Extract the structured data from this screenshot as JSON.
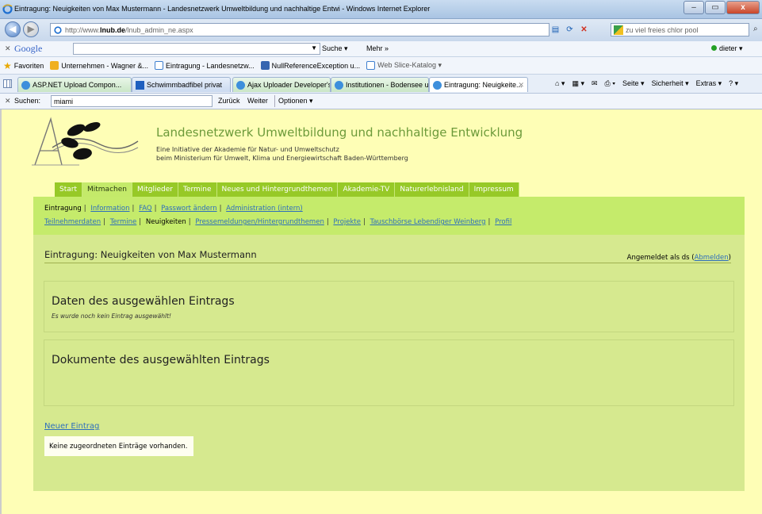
{
  "window": {
    "title": "Eintragung: Neuigkeiten von Max Mustermann - Landesnetzwerk Umweltbildung und nachhaltige Entwi - Windows Internet Explorer",
    "minimize": "–",
    "maximize": "▭",
    "close": "x"
  },
  "address": {
    "url_prefix": "http://www.",
    "url_domain": "lnub.de",
    "url_path": "/lnub_admin_ne.aspx",
    "search_value": "zu viel freies chlor pool"
  },
  "google": {
    "logo": "Google",
    "search_label": "Suche ▾",
    "more_label": "Mehr »",
    "user_label": "dieter ▾"
  },
  "favorites": {
    "label": "Favoriten",
    "items": [
      "Unternehmen - Wagner &...",
      "Eintragung - Landesnetzw...",
      "NullReferenceException u...",
      "Web Slice-Katalog ▾"
    ]
  },
  "tabs": [
    "ASP.NET Upload Compon...",
    "Schwimmbadfibel privat",
    "Ajax Uploader Developer's ...",
    "Institutionen - Bodensee u...",
    "Eintragung: Neuigkeite..."
  ],
  "toolbar_tools": [
    "Seite ▾",
    "Sicherheit ▾",
    "Extras ▾"
  ],
  "findbar": {
    "label": "Suchen:",
    "value": "miami",
    "prev": "Zurück",
    "next": "Weiter",
    "options": "Optionen ▾"
  },
  "site": {
    "title": "Landesnetzwerk Umweltbildung und nachhaltige Entwicklung",
    "subline1": "Eine Initiative der Akademie für Natur- und Umweltschutz",
    "subline2": "beim Ministerium für Umwelt, Klima und Energiewirtschaft Baden-Württemberg"
  },
  "menu": [
    "Start",
    "Mitmachen",
    "Mitglieder",
    "Termine",
    "Neues und Hintergrundthemen",
    "Akademie-TV",
    "Naturerlebnisland",
    "Impressum"
  ],
  "subnav": {
    "row1": [
      "Eintragung",
      "Information",
      "FAQ",
      "Passwort ändern",
      "Administration (intern)"
    ],
    "row2": [
      "Teilnehmerdaten",
      "Termine",
      "Neuigkeiten",
      "Pressemeldungen/Hintergrundthemen",
      "Projekte",
      "Tauschbörse Lebendiger Weinberg",
      "Profil"
    ]
  },
  "main": {
    "heading": "Eintragung: Neuigkeiten von Max Mustermann",
    "logged_prefix": "Angemeldet als ds (",
    "logout": "Abmelden",
    "logged_suffix": ")",
    "box1_title": "Daten des ausgewählen Eintrags",
    "box1_note": "Es wurde noch kein Eintrag ausgewählt!",
    "box2_title": "Dokumente des ausgewählten Eintrags",
    "new_entry": "Neuer Eintrag",
    "empty_msg": "Keine zugeordneten Einträge vorhanden."
  }
}
